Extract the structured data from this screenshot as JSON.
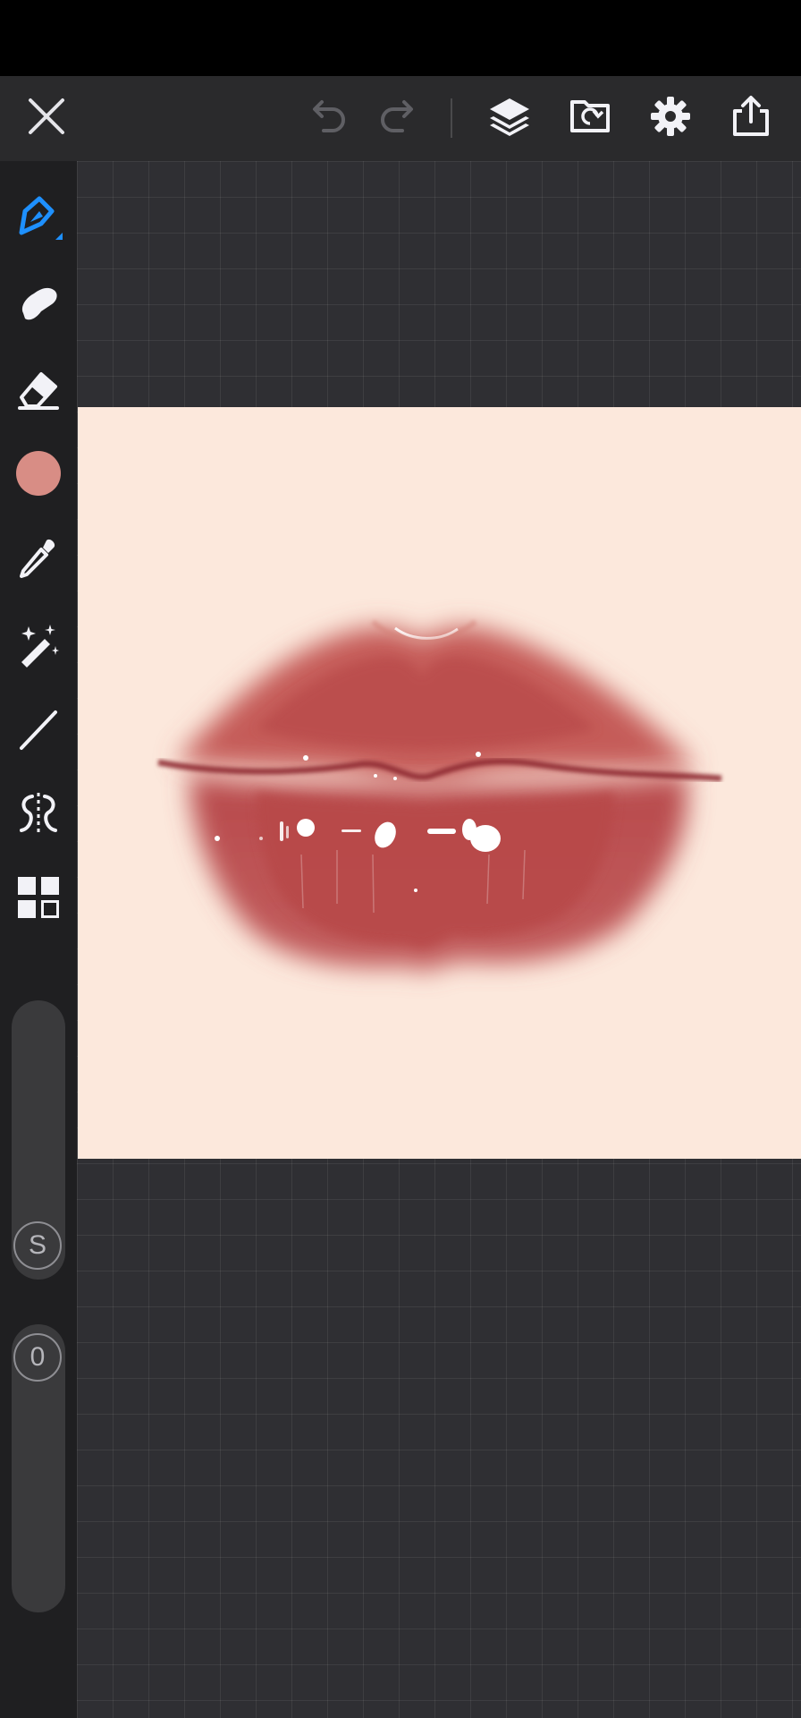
{
  "app": {
    "toolbar": {
      "close": "close-icon",
      "undo": "undo-icon",
      "redo": "redo-icon",
      "layers": "layers-icon",
      "import": "import-icon",
      "settings": "gear-icon",
      "export": "share-icon"
    },
    "tools": [
      {
        "name": "brush-tool",
        "icon": "pen-icon",
        "active": true
      },
      {
        "name": "smudge-tool",
        "icon": "smudge-icon"
      },
      {
        "name": "eraser-tool",
        "icon": "eraser-icon"
      },
      {
        "name": "color-swatch",
        "color": "#d88d85"
      },
      {
        "name": "eyedropper-tool",
        "icon": "eyedropper-icon"
      },
      {
        "name": "magic-wand-tool",
        "icon": "magic-wand-icon"
      },
      {
        "name": "line-tool",
        "icon": "line-icon"
      },
      {
        "name": "symmetry-tool",
        "icon": "symmetry-icon"
      },
      {
        "name": "gallery-tool",
        "icon": "grid-icon"
      }
    ],
    "size_slider": {
      "label": "S"
    },
    "opacity_slider": {
      "label": "0"
    },
    "colors": {
      "accent": "#1e90ff",
      "current_color": "#d88d85",
      "canvas_bg": "#fce8dc"
    }
  }
}
